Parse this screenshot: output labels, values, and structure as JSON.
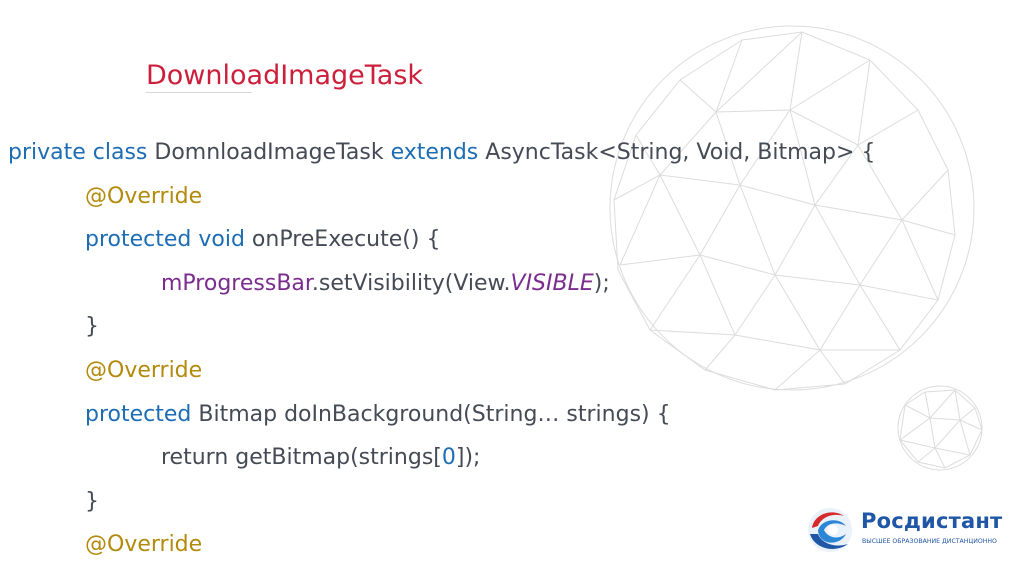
{
  "slide": {
    "title": "DownloadImageTask"
  },
  "code_lines": [
    {
      "indent": 0,
      "tokens": [
        {
          "text": "private class ",
          "style": "kw"
        },
        {
          "text": "DomnloadImageTask ",
          "style": "plain"
        },
        {
          "text": "extends ",
          "style": "kw"
        },
        {
          "text": "AsyncTask<String, Void, Bitmap> {",
          "style": "plain"
        }
      ]
    },
    {
      "indent": 1,
      "tokens": [
        {
          "text": "@Override",
          "style": "ann"
        }
      ]
    },
    {
      "indent": 1,
      "tokens": [
        {
          "text": "protected void ",
          "style": "kw"
        },
        {
          "text": "onPreExecute() {",
          "style": "plain"
        }
      ]
    },
    {
      "indent": 2,
      "tokens": [
        {
          "text": "mProgressBar",
          "style": "fld"
        },
        {
          "text": ".setVisibility(View.",
          "style": "plain"
        },
        {
          "text": "VISIBLE",
          "style": "const"
        },
        {
          "text": ");",
          "style": "plain"
        }
      ]
    },
    {
      "indent": 1,
      "tokens": [
        {
          "text": "}",
          "style": "plain"
        }
      ]
    },
    {
      "indent": 1,
      "tokens": [
        {
          "text": "@Override",
          "style": "ann"
        }
      ]
    },
    {
      "indent": 1,
      "tokens": [
        {
          "text": "protected ",
          "style": "kw"
        },
        {
          "text": "Bitmap doInBackground(String… strings) {",
          "style": "plain"
        }
      ]
    },
    {
      "indent": 2,
      "tokens": [
        {
          "text": "return getBitmap(strings[",
          "style": "plain"
        },
        {
          "text": "0",
          "style": "num"
        },
        {
          "text": "]);",
          "style": "plain"
        }
      ]
    },
    {
      "indent": 1,
      "tokens": [
        {
          "text": "}",
          "style": "plain"
        }
      ]
    },
    {
      "indent": 1,
      "tokens": [
        {
          "text": "@Override",
          "style": "ann"
        }
      ]
    }
  ],
  "logo": {
    "brand": "Росдистант",
    "tagline": "ВЫСШЕЕ ОБРАЗОВАНИЕ ДИСТАНЦИОННО"
  },
  "colors": {
    "title": "#cc1f3c",
    "keyword": "#1d6db5",
    "annotation": "#b38a0c",
    "field": "#7b2d8e",
    "plain_code": "#444b55",
    "brand_blue": "#1f56a6",
    "brand_red": "#d62a2a"
  },
  "icons": {
    "background": "geodesic-sphere-icon",
    "logo": "rosdistant-swirl-logo-icon"
  }
}
